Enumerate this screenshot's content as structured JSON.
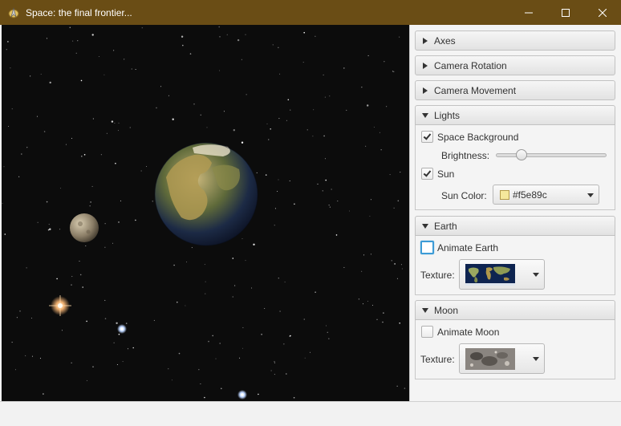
{
  "window": {
    "title": "Space: the final frontier...",
    "icon": "starfleet-icon",
    "controls": [
      "minimize-icon",
      "maximize-icon",
      "close-icon"
    ]
  },
  "panels": {
    "axes": {
      "title": "Axes",
      "expanded": false
    },
    "camera_rotation": {
      "title": "Camera Rotation",
      "expanded": false
    },
    "camera_movement": {
      "title": "Camera Movement",
      "expanded": false
    },
    "lights": {
      "title": "Lights",
      "expanded": true,
      "space_background": {
        "label": "Space Background",
        "checked": true
      },
      "brightness": {
        "label": "Brightness:",
        "value": 0.2
      },
      "sun": {
        "label": "Sun",
        "checked": true
      },
      "sun_color": {
        "label": "Sun Color:",
        "value": "#f5e89c",
        "swatch": "#f5e89c"
      }
    },
    "earth": {
      "title": "Earth",
      "expanded": true,
      "animate": {
        "label": "Animate Earth",
        "checked": false
      },
      "texture_label": "Texture:",
      "texture_icon": "earth-map-thumbnail"
    },
    "moon": {
      "title": "Moon",
      "expanded": true,
      "animate": {
        "label": "Animate Moon",
        "checked": false
      },
      "texture_label": "Texture:",
      "texture_icon": "moon-map-thumbnail"
    }
  },
  "colors": {
    "titlebar": "#6a4d15",
    "space": "#0c0c0c",
    "focus": "#3c9bd6"
  }
}
